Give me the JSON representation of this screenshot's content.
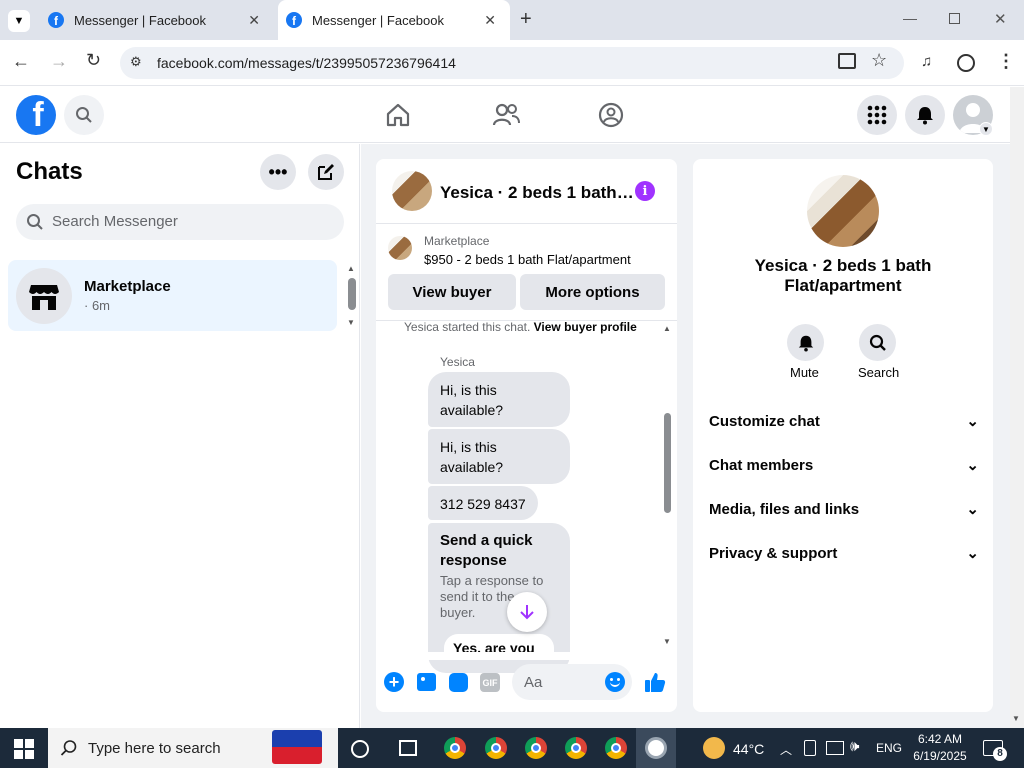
{
  "browser": {
    "tabs": [
      {
        "title": "Messenger | Facebook"
      },
      {
        "title": "Messenger | Facebook"
      }
    ],
    "url": "facebook.com/messages/t/23995057236796414"
  },
  "sidebar": {
    "title": "Chats",
    "search_placeholder": "Search Messenger",
    "chats": [
      {
        "name": "Marketplace",
        "time": "· 6m"
      }
    ]
  },
  "conversation": {
    "title": "Yesica · 2 beds 1 bath…",
    "listing_source": "Marketplace",
    "listing_text": "$950 - 2 beds 1 bath Flat/apartment",
    "view_buyer_label": "View buyer",
    "more_options_label": "More options",
    "system_note": "Yesica started this chat.",
    "system_link": "View buyer profile",
    "sender": "Yesica",
    "messages": [
      {
        "text": "Hi, is this available?"
      },
      {
        "text": "Hi, is this available?"
      },
      {
        "text": "312 529 8437"
      }
    ],
    "quick_response": {
      "title": "Send a quick response",
      "subtitle": "Tap a response to send it to the buyer.",
      "option": "Yes, are you"
    },
    "composer_placeholder": "Aa",
    "gif_label": "GIF"
  },
  "info_panel": {
    "title": "Yesica · 2 beds 1 bath Flat/apartment",
    "mute_label": "Mute",
    "search_label": "Search",
    "sections": [
      {
        "label": "Customize chat"
      },
      {
        "label": "Chat members"
      },
      {
        "label": "Media, files and links"
      },
      {
        "label": "Privacy & support"
      }
    ]
  },
  "taskbar": {
    "search_placeholder": "Type here to search",
    "weather": "44°C",
    "language": "ENG",
    "time": "6:42 AM",
    "date": "6/19/2025",
    "notifications": "8"
  },
  "colors": {
    "brand": "#1877f2",
    "purple": "#a033ff",
    "accent_blue": "#0084ff"
  }
}
